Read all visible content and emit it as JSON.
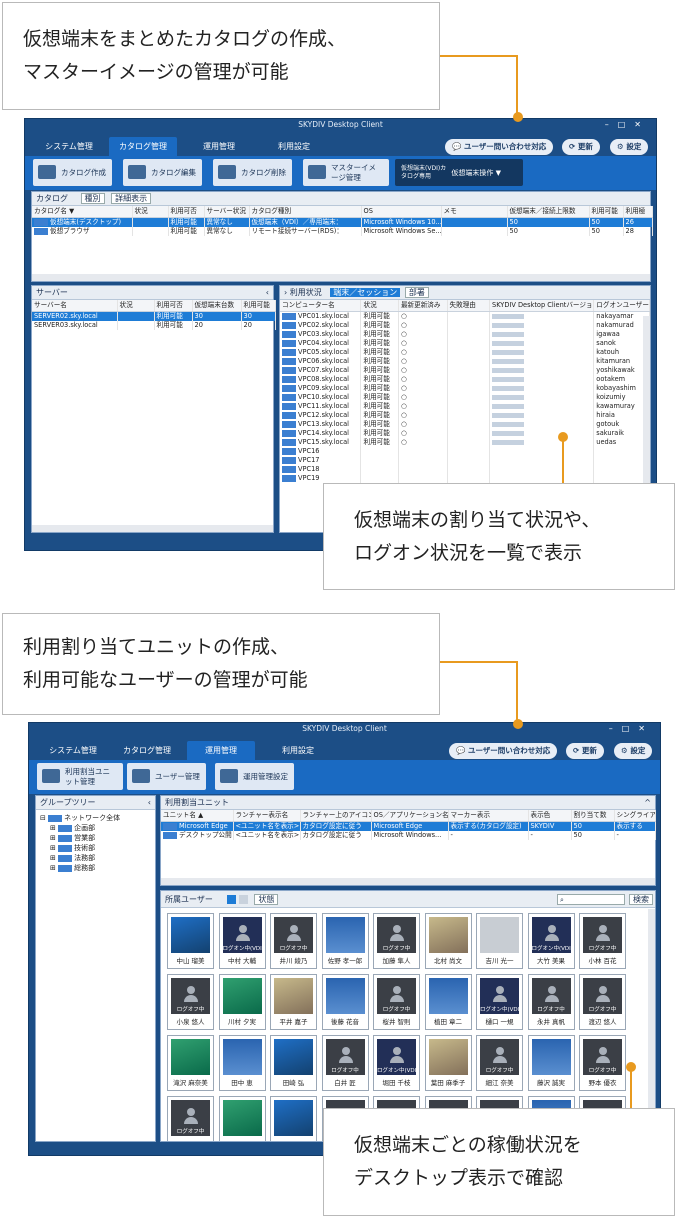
{
  "callouts": [
    {
      "line1": "仮想端末をまとめたカタログの作成、",
      "line2": "マスターイメージの管理が可能"
    },
    {
      "line1": "仮想端末の割り当て状況や、",
      "line2": "ログオン状況を一覧で表示"
    },
    {
      "line1": "利用割り当てユニットの作成、",
      "line2": "利用可能なユーザーの管理が可能"
    },
    {
      "line1": "仮想端末ごとの稼働状況を",
      "line2": "デスクトップ表示で確認"
    }
  ],
  "accent": "#e89a1f",
  "win1": {
    "title": "SKYDIV Desktop Client",
    "tabs": [
      "システム管理",
      "カタログ管理",
      "運用管理",
      "利用設定"
    ],
    "inquiry": "ユーザー問い合わせ対応",
    "refresh": "更新",
    "settings": "設定",
    "ribbon": [
      "カタログ作成",
      "カタログ編集",
      "カタログ削除",
      "マスターイメージ管理"
    ],
    "vdi_label": "仮想端末(VDI)カタログ専用",
    "vdi_action": "仮想端末操作 ▼",
    "catalog_title": "カタログ",
    "kind": "種別",
    "detail": "詳細表示",
    "catalog_cols": [
      "カタログ名 ▼",
      "状況",
      "利用可否",
      "サーバー状況",
      "カタログ種別",
      "OS",
      "メモ",
      "仮想端末／接続上限数",
      "利用可能",
      "利用極"
    ],
    "catalog_rows": [
      [
        "仮想端末(デスクトップ)",
        "",
        "利用可能",
        "異常なし",
        "仮想端末（VDI）／専用端末：",
        "Microsoft Windows 10...",
        "",
        "50",
        "50",
        "26"
      ],
      [
        "仮想ブラウザ",
        "",
        "利用可能",
        "異常なし",
        "リモート接続サーバー(RDS)：",
        "Microsoft Windows Se...",
        "",
        "50",
        "50",
        "28"
      ]
    ],
    "server_title": "サーバー",
    "server_cols": [
      "サーバー名",
      "状況",
      "利用可否",
      "仮想端末台数",
      "利用可能"
    ],
    "server_rows": [
      [
        "SERVER02.sky.local",
        "",
        "利用可能",
        "30",
        "30"
      ],
      [
        "SERVER03.sky.local",
        "",
        "利用可能",
        "20",
        "20"
      ]
    ],
    "usage_title": "利用状況",
    "usage_tab1": "端末／セッション",
    "usage_tab2": "部署",
    "usage_cols": [
      "コンピューター名",
      "状況",
      "最新更新済み",
      "失敗理由",
      "SKYDIV Desktop Clientバージョン",
      "ログオンユーザー"
    ],
    "usage_rows": [
      [
        "VPC01.sky.local",
        "利用可能",
        "○",
        "nakayamar"
      ],
      [
        "VPC02.sky.local",
        "利用可能",
        "○",
        "nakamurad"
      ],
      [
        "VPC03.sky.local",
        "利用可能",
        "○",
        "igawaa"
      ],
      [
        "VPC04.sky.local",
        "利用可能",
        "○",
        "sanok"
      ],
      [
        "VPC05.sky.local",
        "利用可能",
        "○",
        "katouh"
      ],
      [
        "VPC06.sky.local",
        "利用可能",
        "○",
        "kitamuran"
      ],
      [
        "VPC07.sky.local",
        "利用可能",
        "○",
        "yoshikawak"
      ],
      [
        "VPC08.sky.local",
        "利用可能",
        "○",
        "ootakem"
      ],
      [
        "VPC09.sky.local",
        "利用可能",
        "○",
        "kobayashim"
      ],
      [
        "VPC10.sky.local",
        "利用可能",
        "○",
        "koizumiy"
      ],
      [
        "VPC11.sky.local",
        "利用可能",
        "○",
        "kawamuray"
      ],
      [
        "VPC12.sky.local",
        "利用可能",
        "○",
        "hiraia"
      ],
      [
        "VPC13.sky.local",
        "利用可能",
        "○",
        "gotouk"
      ],
      [
        "VPC14.sky.local",
        "利用可能",
        "○",
        "sakuraik"
      ],
      [
        "VPC15.sky.local",
        "利用可能",
        "○",
        "uedas"
      ],
      [
        "VPC16",
        "",
        "",
        ""
      ],
      [
        "VPC17",
        "",
        "",
        ""
      ],
      [
        "VPC18",
        "",
        "",
        ""
      ],
      [
        "VPC19",
        "",
        "",
        ""
      ]
    ]
  },
  "win2": {
    "title": "SKYDIV Desktop Client",
    "tabs": [
      "システム管理",
      "カタログ管理",
      "運用管理",
      "利用設定"
    ],
    "inquiry": "ユーザー問い合わせ対応",
    "refresh": "更新",
    "settings": "設定",
    "ribbon": [
      "利用割当ユニット管理",
      "ユーザー管理",
      "運用管理設定"
    ],
    "group_title": "グループツリー",
    "tree": [
      "ネットワーク全体",
      "企画部",
      "営業部",
      "技術部",
      "法務部",
      "総務部"
    ],
    "unit_title": "利用割当ユニット",
    "unit_cols": [
      "ユニット名 ▲",
      "ランチャー表示名",
      "ランチャー上のアイコン",
      "OS／アプリケーション名",
      "マーカー表示",
      "表示色",
      "割り当て数",
      "シングライアン"
    ],
    "unit_rows": [
      [
        "Microsoft Edge",
        "<ユニット名を表示>",
        "カタログ設定に従う",
        "Microsoft Edge",
        "表示する(カタログ設定)",
        "SKYDIV",
        "50",
        "表示する"
      ],
      [
        "デスクトップ公開",
        "<ユニット名を表示>",
        "カタログ設定に従う",
        "Microsoft Windows...",
        "-",
        "-",
        "50",
        "-"
      ]
    ],
    "members_title": "所属ユーザー",
    "state_filter": "状態",
    "search_btn": "検索",
    "logoff": "ログオフ中",
    "logon": "ログオン中(VDI)",
    "thumbs": [
      [
        "中山 瑠美",
        "blu",
        ""
      ],
      [
        "中村 大輔",
        "ond",
        "logon"
      ],
      [
        "井川 綾乃",
        "off",
        "logoff"
      ],
      [
        "佐野 孝一郎",
        "app",
        ""
      ],
      [
        "加藤 隼人",
        "off",
        "logoff"
      ],
      [
        "北村 尚文",
        "mix",
        ""
      ],
      [
        "吉川 光一",
        "gry",
        ""
      ],
      [
        "大竹 美果",
        "ond",
        "logon"
      ],
      [
        "小林 百花",
        "off",
        "logoff"
      ],
      [
        "小泉 悠人",
        "off",
        "logoff"
      ],
      [
        "川村 夕実",
        "grn",
        ""
      ],
      [
        "平井 嘉子",
        "mix",
        ""
      ],
      [
        "後藤 花音",
        "app",
        ""
      ],
      [
        "桜井 智則",
        "off",
        "logoff"
      ],
      [
        "植田 章二",
        "app",
        ""
      ],
      [
        "樋口 一規",
        "ond",
        "logon"
      ],
      [
        "永井 真帆",
        "off",
        "logoff"
      ],
      [
        "渡辺 悠人",
        "off",
        "logoff"
      ],
      [
        "滝沢 麻奈美",
        "grn",
        ""
      ],
      [
        "田中 恵",
        "app",
        ""
      ],
      [
        "田崎 弘",
        "blu",
        ""
      ],
      [
        "白井 匠",
        "off",
        "logoff"
      ],
      [
        "堀田 千枝",
        "ond",
        "logon"
      ],
      [
        "葉田 麻季子",
        "mix",
        ""
      ],
      [
        "細江 奈美",
        "off",
        "logoff"
      ],
      [
        "藤沢 誠実",
        "app",
        ""
      ],
      [
        "野本 優衣",
        "off",
        "logoff"
      ],
      [
        "",
        "off",
        "logoff"
      ],
      [
        "",
        "grn",
        ""
      ],
      [
        "",
        "blu",
        ""
      ],
      [
        "",
        "off",
        "logoff"
      ],
      [
        "",
        "off",
        "logoff"
      ],
      [
        "",
        "off",
        "logoff"
      ],
      [
        "",
        "off",
        "logoff"
      ],
      [
        "",
        "app",
        ""
      ],
      [
        "",
        "off",
        "logoff"
      ]
    ]
  }
}
